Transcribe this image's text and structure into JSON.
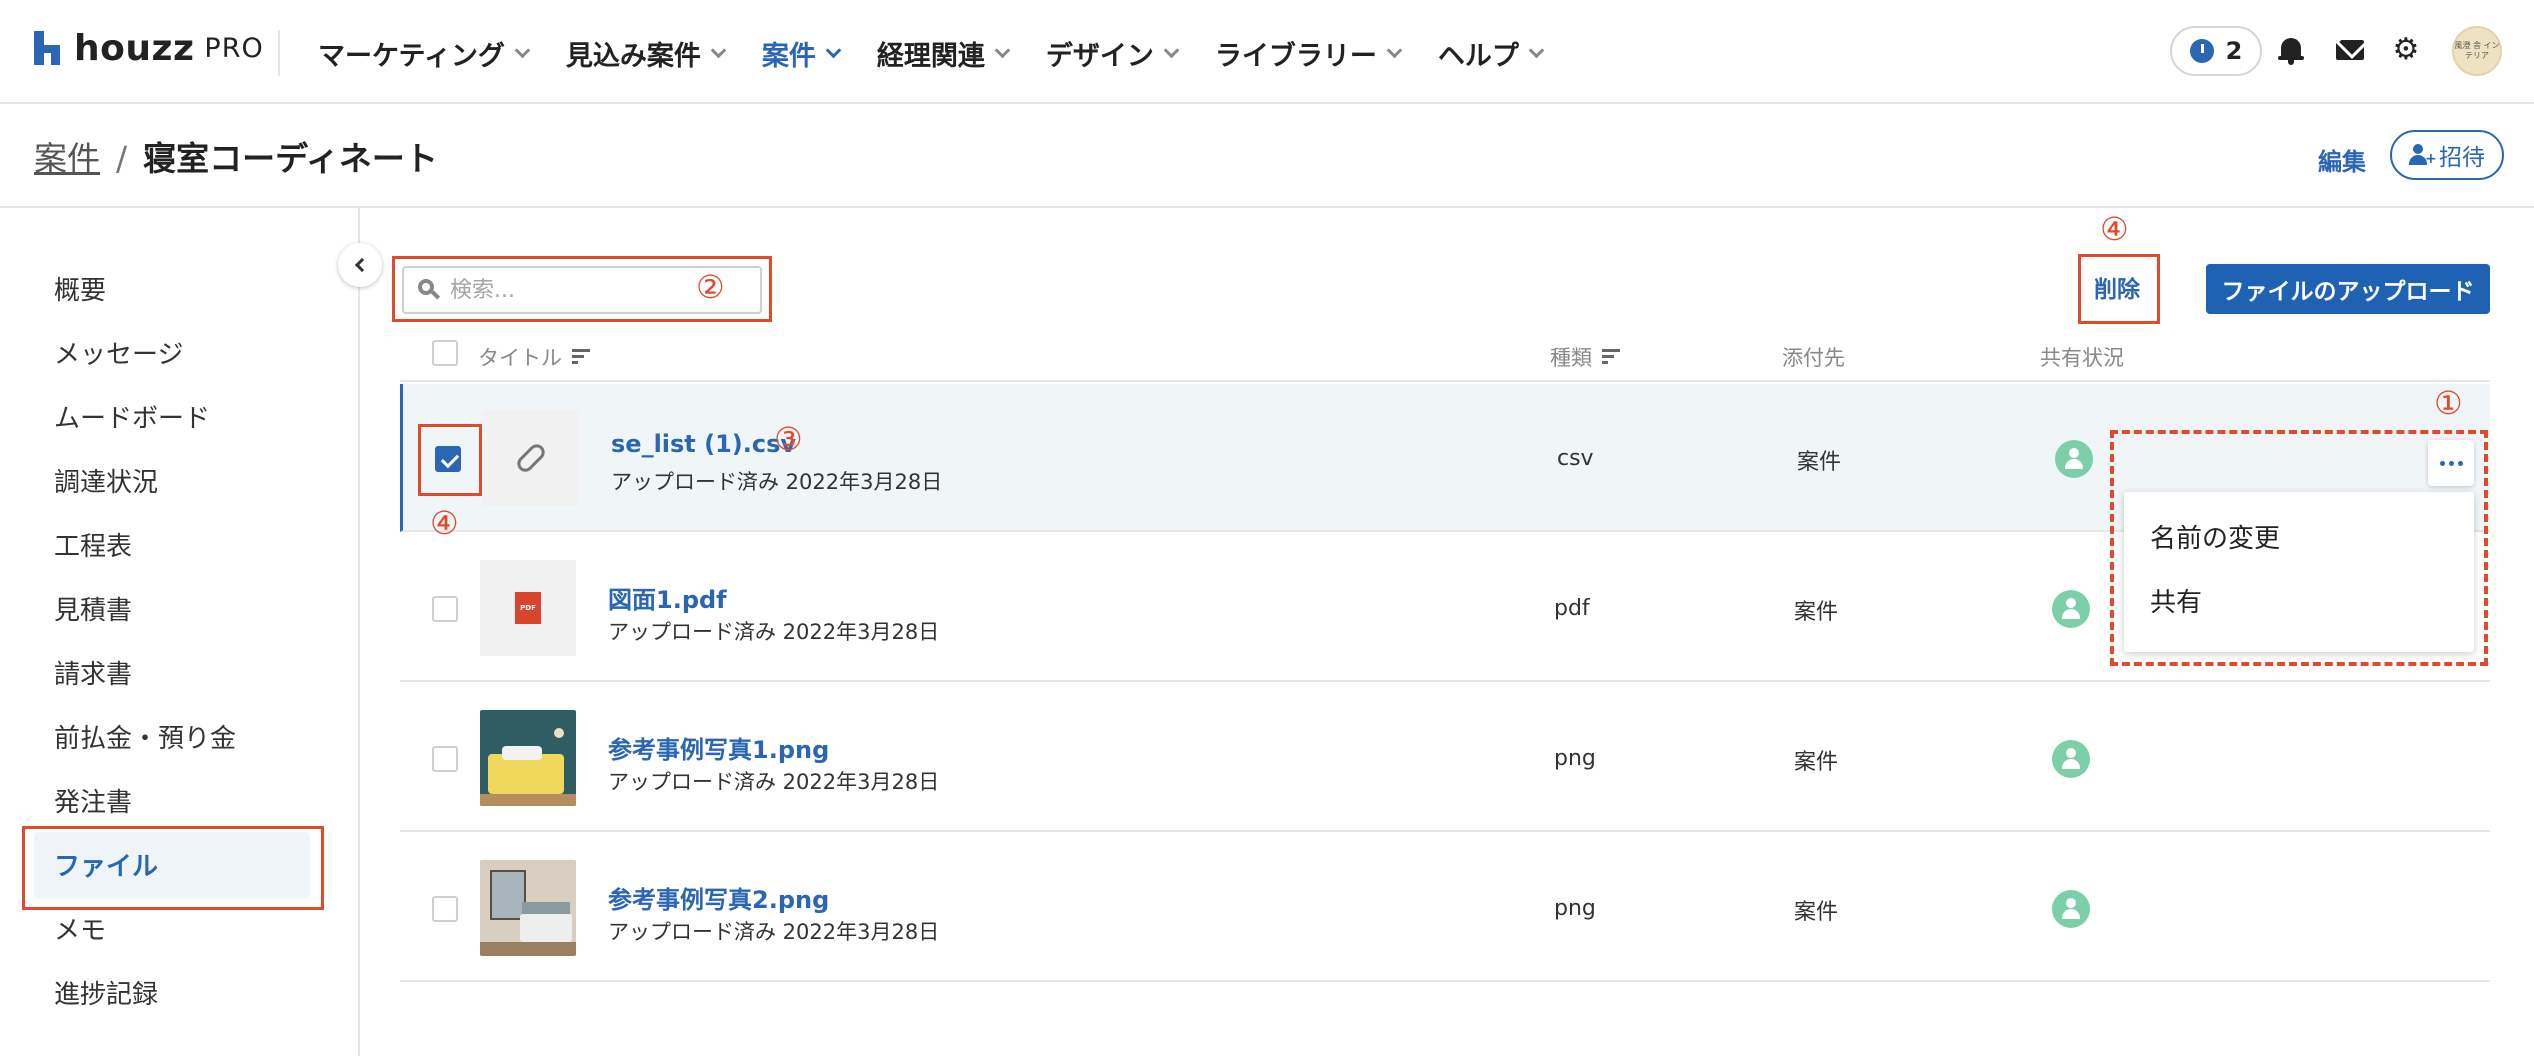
{
  "brand": {
    "word": "houzz",
    "suffix": "PRO"
  },
  "nav": [
    {
      "label": "マーケティング",
      "active": false
    },
    {
      "label": "見込み案件",
      "active": false
    },
    {
      "label": "案件",
      "active": true
    },
    {
      "label": "経理関連",
      "active": false
    },
    {
      "label": "デザイン",
      "active": false
    },
    {
      "label": "ライブラリー",
      "active": false
    },
    {
      "label": "ヘルプ",
      "active": false
    }
  ],
  "header": {
    "timer_count": "2",
    "avatar_text": "風澄 舎 インテリア"
  },
  "breadcrumb": {
    "parent": "案件",
    "separator": "/",
    "current": "寝室コーディネート"
  },
  "actions": {
    "edit_label": "編集",
    "invite_label": "招待"
  },
  "sidebar": {
    "items": [
      {
        "label": "概要"
      },
      {
        "label": "メッセージ"
      },
      {
        "label": "ムードボード"
      },
      {
        "label": "調達状況"
      },
      {
        "label": "工程表"
      },
      {
        "label": "見積書"
      },
      {
        "label": "請求書"
      },
      {
        "label": "前払金・預り金"
      },
      {
        "label": "発注書"
      },
      {
        "label": "ファイル",
        "active": true
      },
      {
        "label": "メモ"
      },
      {
        "label": "進捗記録"
      }
    ]
  },
  "toolbar": {
    "search_placeholder": "検索...",
    "delete_label": "削除",
    "upload_label": "ファイルのアップロード"
  },
  "table": {
    "headers": {
      "title": "タイトル",
      "type": "種類",
      "attached": "添付先",
      "sharing": "共有状況"
    },
    "rows": [
      {
        "name": "se_list (1).csv",
        "uploaded": "アップロード済み 2022年3月28日",
        "type": "csv",
        "attached": "案件",
        "checked": true,
        "thumb": "paperclip-icon"
      },
      {
        "name": "図面1.pdf",
        "uploaded": "アップロード済み 2022年3月28日",
        "type": "pdf",
        "attached": "案件",
        "checked": false,
        "thumb": "pdf-icon",
        "thumb_text": "PDF"
      },
      {
        "name": "参考事例写真1.png",
        "uploaded": "アップロード済み 2022年3月28日",
        "type": "png",
        "attached": "案件",
        "checked": false,
        "thumb": "photo"
      },
      {
        "name": "参考事例写真2.png",
        "uploaded": "アップロード済み 2022年3月28日",
        "type": "png",
        "attached": "案件",
        "checked": false,
        "thumb": "photo"
      }
    ]
  },
  "context_menu": {
    "items": [
      "名前の変更",
      "共有"
    ]
  },
  "annotations": {
    "n1": "①",
    "n2": "②",
    "n3": "③",
    "n4": "④"
  },
  "colors": {
    "accent": "#2a66b3",
    "annotation": "#e04b2e",
    "selected_row": "#f0f5f8",
    "share": "#7dcfa9"
  }
}
